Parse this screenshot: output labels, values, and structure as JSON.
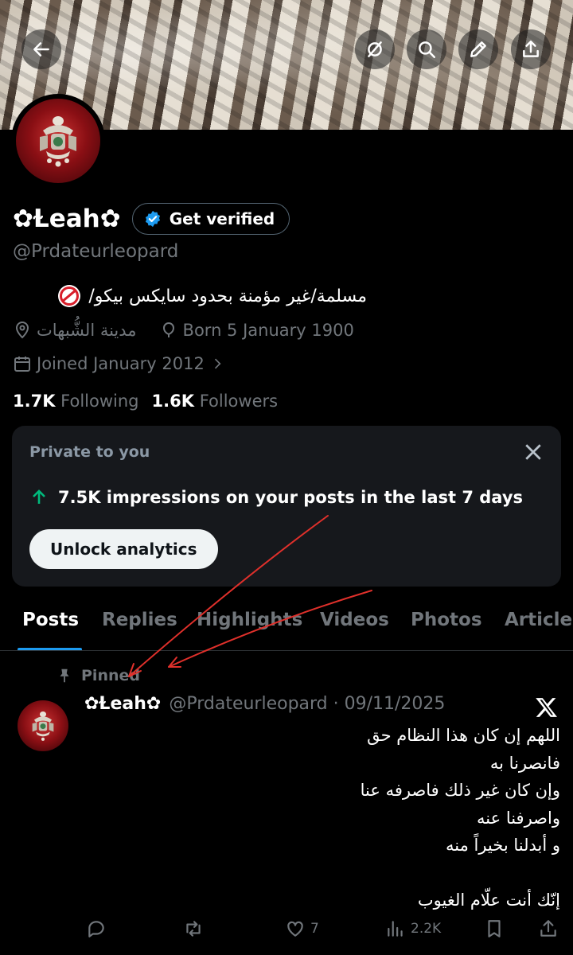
{
  "profile": {
    "display_name": "✿Ɫeah✿",
    "handle": "@Prdateurleopard",
    "verify_label": "Get verified",
    "bio": "مسلمة/غير مؤمنة بحدود سايكس بيكو/",
    "location": "مدينة الشُّبهات",
    "born": "Born 5 January 1900",
    "joined": "Joined January 2012",
    "following_count": "1.7K",
    "following_label": "Following",
    "followers_count": "1.6K",
    "followers_label": "Followers"
  },
  "analytics_card": {
    "title": "Private to you",
    "stat": "7.5K impressions on your posts in the last 7 days",
    "button_label": "Unlock analytics"
  },
  "tabs": [
    {
      "label": "Posts",
      "active": true
    },
    {
      "label": "Replies"
    },
    {
      "label": "Highlights"
    },
    {
      "label": "Videos"
    },
    {
      "label": "Photos"
    },
    {
      "label": "Articles"
    }
  ],
  "post": {
    "pinned_label": "Pinned",
    "author_name": "✿Ɫeah✿",
    "author_meta": "@Prdateurleopard · 09/11/2025",
    "lines": [
      "اللهم إن كان هذا النظام حق",
      "فانصرنا به",
      "وإن كان غير ذلك فاصرفه عنا",
      "واصرفنا عنه",
      "و أبدلنا بخيراً منه",
      "",
      "إنّك أنت علّام الغيوب"
    ],
    "likes": "7",
    "views": "2.2K"
  },
  "icons": {
    "back": "back-arrow-icon",
    "grok": "grok-icon",
    "search": "search-icon",
    "edit": "pencil-icon",
    "share": "share-icon"
  },
  "colors": {
    "background": "#000000",
    "card": "#16181c",
    "accent_blue": "#1d9bf0",
    "impression_green": "#00ba7c",
    "annotation_red": "#e0302b"
  }
}
